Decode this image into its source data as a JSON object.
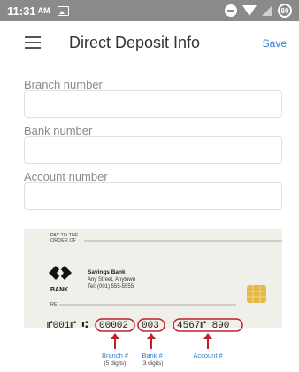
{
  "status_bar": {
    "time": "11:31",
    "ampm": "AM",
    "battery_label": "80"
  },
  "app_bar": {
    "title": "Direct Deposit Info",
    "save_label": "Save"
  },
  "form": {
    "branch": {
      "label": "Branch number",
      "value": "",
      "placeholder": ""
    },
    "bank": {
      "label": "Bank number",
      "value": "",
      "placeholder": ""
    },
    "account": {
      "label": "Account number",
      "value": "",
      "placeholder": ""
    }
  },
  "check": {
    "pay_to_line1": "PAY TO THE",
    "pay_to_line2": "ORDER OF",
    "bank_logo_text": "BANK",
    "bank_name": "Savings Bank",
    "bank_address": "Any Street, Anytown",
    "bank_tel": "Tel: (001) 555-5555",
    "re_label": "RE",
    "micr_prefix": "⑈001⑈ ⑆",
    "branch_digits": "00002",
    "bank_digits": "003",
    "account_digits": "4567⑈ 890",
    "branch_caption": "Branch #",
    "branch_sub": "(5 digits)",
    "bank_caption": "Bank #",
    "bank_sub": "(3 digits)",
    "account_caption": "Account #",
    "colors": {
      "highlight": "#c0202a",
      "caption": "#2f7fd6",
      "check_bg": "#f1efe9"
    }
  }
}
